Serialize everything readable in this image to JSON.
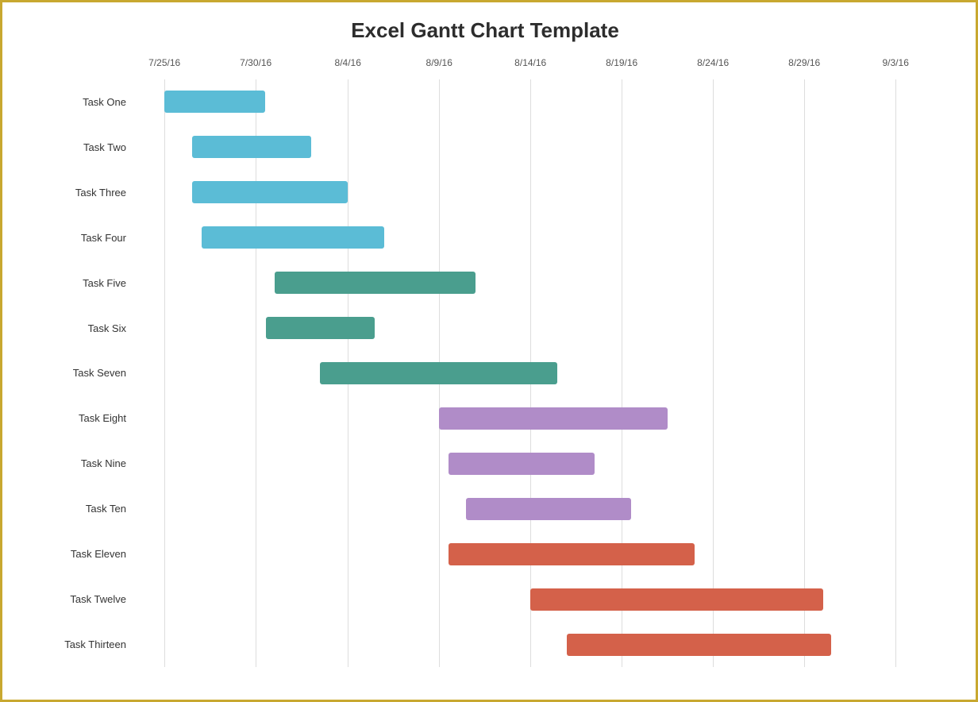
{
  "title": "Excel Gantt Chart Template",
  "chart": {
    "start_date": "2016-07-22",
    "total_days": 45,
    "date_labels": [
      {
        "label": "7/25/16",
        "offset_pct": 3.3
      },
      {
        "label": "7/30/16",
        "offset_pct": 14.4
      },
      {
        "label": "8/4/16",
        "offset_pct": 25.6
      },
      {
        "label": "8/9/16",
        "offset_pct": 36.7
      },
      {
        "label": "8/14/16",
        "offset_pct": 47.8
      },
      {
        "label": "8/19/16",
        "offset_pct": 58.9
      },
      {
        "label": "8/24/16",
        "offset_pct": 70.0
      },
      {
        "label": "8/29/16",
        "offset_pct": 81.1
      },
      {
        "label": "9/3/16",
        "offset_pct": 92.2
      }
    ],
    "grid_offsets_pct": [
      3.3,
      14.4,
      25.6,
      36.7,
      47.8,
      58.9,
      70.0,
      81.1,
      92.2
    ],
    "tasks": [
      {
        "name": "Task One",
        "left_pct": 3.3,
        "width_pct": 12.2,
        "color": "color-blue"
      },
      {
        "name": "Task Two",
        "left_pct": 6.7,
        "width_pct": 14.4,
        "color": "color-blue"
      },
      {
        "name": "Task Three",
        "left_pct": 6.7,
        "width_pct": 18.9,
        "color": "color-blue"
      },
      {
        "name": "Task Four",
        "left_pct": 7.8,
        "width_pct": 22.2,
        "color": "color-blue"
      },
      {
        "name": "Task Five",
        "left_pct": 16.7,
        "width_pct": 24.4,
        "color": "color-teal"
      },
      {
        "name": "Task Six",
        "left_pct": 15.6,
        "width_pct": 13.3,
        "color": "color-teal"
      },
      {
        "name": "Task Seven",
        "left_pct": 22.2,
        "width_pct": 28.9,
        "color": "color-teal"
      },
      {
        "name": "Task Eight",
        "left_pct": 36.7,
        "width_pct": 27.8,
        "color": "color-purple"
      },
      {
        "name": "Task Nine",
        "left_pct": 37.8,
        "width_pct": 17.8,
        "color": "color-purple"
      },
      {
        "name": "Task Ten",
        "left_pct": 40.0,
        "width_pct": 20.0,
        "color": "color-purple"
      },
      {
        "name": "Task Eleven",
        "left_pct": 37.8,
        "width_pct": 30.0,
        "color": "color-red"
      },
      {
        "name": "Task Twelve",
        "left_pct": 47.8,
        "width_pct": 35.6,
        "color": "color-red"
      },
      {
        "name": "Task Thirteen",
        "left_pct": 52.2,
        "width_pct": 32.2,
        "color": "color-red"
      }
    ]
  }
}
